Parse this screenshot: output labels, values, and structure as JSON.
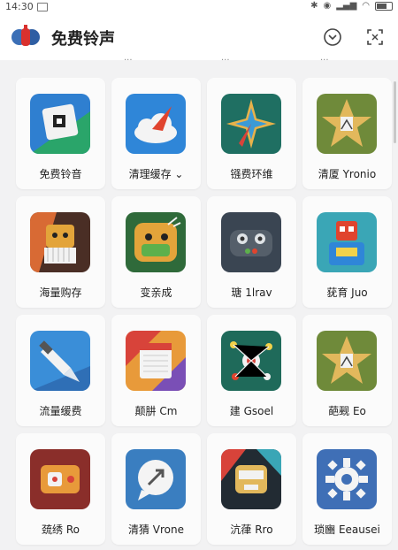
{
  "status": {
    "time": "14:30"
  },
  "app": {
    "title": "免费铃声"
  },
  "peek": [
    "...",
    "...",
    "..."
  ],
  "tiles": [
    {
      "label": "免费铃音",
      "icon": "ringtone-icon"
    },
    {
      "label": "清理缓存 ⌄",
      "icon": "cloud-cleaner-icon"
    },
    {
      "label": "镪费环维",
      "icon": "star-compass-icon"
    },
    {
      "label": "清厦 Yronio",
      "icon": "gold-star-icon"
    },
    {
      "label": "海量购存",
      "icon": "mask-character-icon"
    },
    {
      "label": "变亲成",
      "icon": "creature-face-icon"
    },
    {
      "label": "瑭 1lrav",
      "icon": "gamepad-icon"
    },
    {
      "label": "莸育 Juo",
      "icon": "robot-figure-icon"
    },
    {
      "label": "流量缓费",
      "icon": "cleaning-brush-icon"
    },
    {
      "label": "颠肼 Cm",
      "icon": "calendar-icon"
    },
    {
      "label": "建 Gsoel",
      "icon": "network-nodes-icon"
    },
    {
      "label": "葩觋 Eo",
      "icon": "gold-star-icon"
    },
    {
      "label": "巯绣 Ro",
      "icon": "game-controller-icon"
    },
    {
      "label": "清猜 Vrone",
      "icon": "chat-bubble-icon"
    },
    {
      "label": "沆葎 Rro",
      "icon": "robot-face-icon"
    },
    {
      "label": "琐豳 Eeausei",
      "icon": "gear-icon"
    }
  ]
}
